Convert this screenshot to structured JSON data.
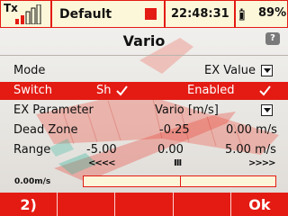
{
  "status_bar": {
    "tx_label": "Tx",
    "model_name": "Default",
    "time": "22:48:31",
    "battery_percent": "89%",
    "colors": {
      "accent": "#e31b13",
      "panel": "#fdf7d9"
    }
  },
  "screen": {
    "title": "Vario",
    "help_icon": "help-icon"
  },
  "rows": {
    "mode": {
      "label": "Mode",
      "value": "EX Value"
    },
    "switch": {
      "label": "Switch",
      "value": "Sh",
      "status": "Enabled"
    },
    "ex_parameter": {
      "label": "EX Parameter",
      "value": "Vario [m/s]"
    },
    "dead_zone": {
      "label": "Dead Zone",
      "value_left": "-0.25",
      "value_right": "0.00 m/s"
    },
    "range": {
      "label": "Range",
      "min": "-5.00",
      "center": "0.00",
      "max": "5.00 m/s",
      "left_arrows": "<<<<",
      "center_marker": "III",
      "right_arrows": ">>>>"
    }
  },
  "vario_bar": {
    "label": "0.00m/s",
    "level": 0.0
  },
  "softkeys": [
    "2)",
    "",
    "",
    "",
    "Ok"
  ]
}
